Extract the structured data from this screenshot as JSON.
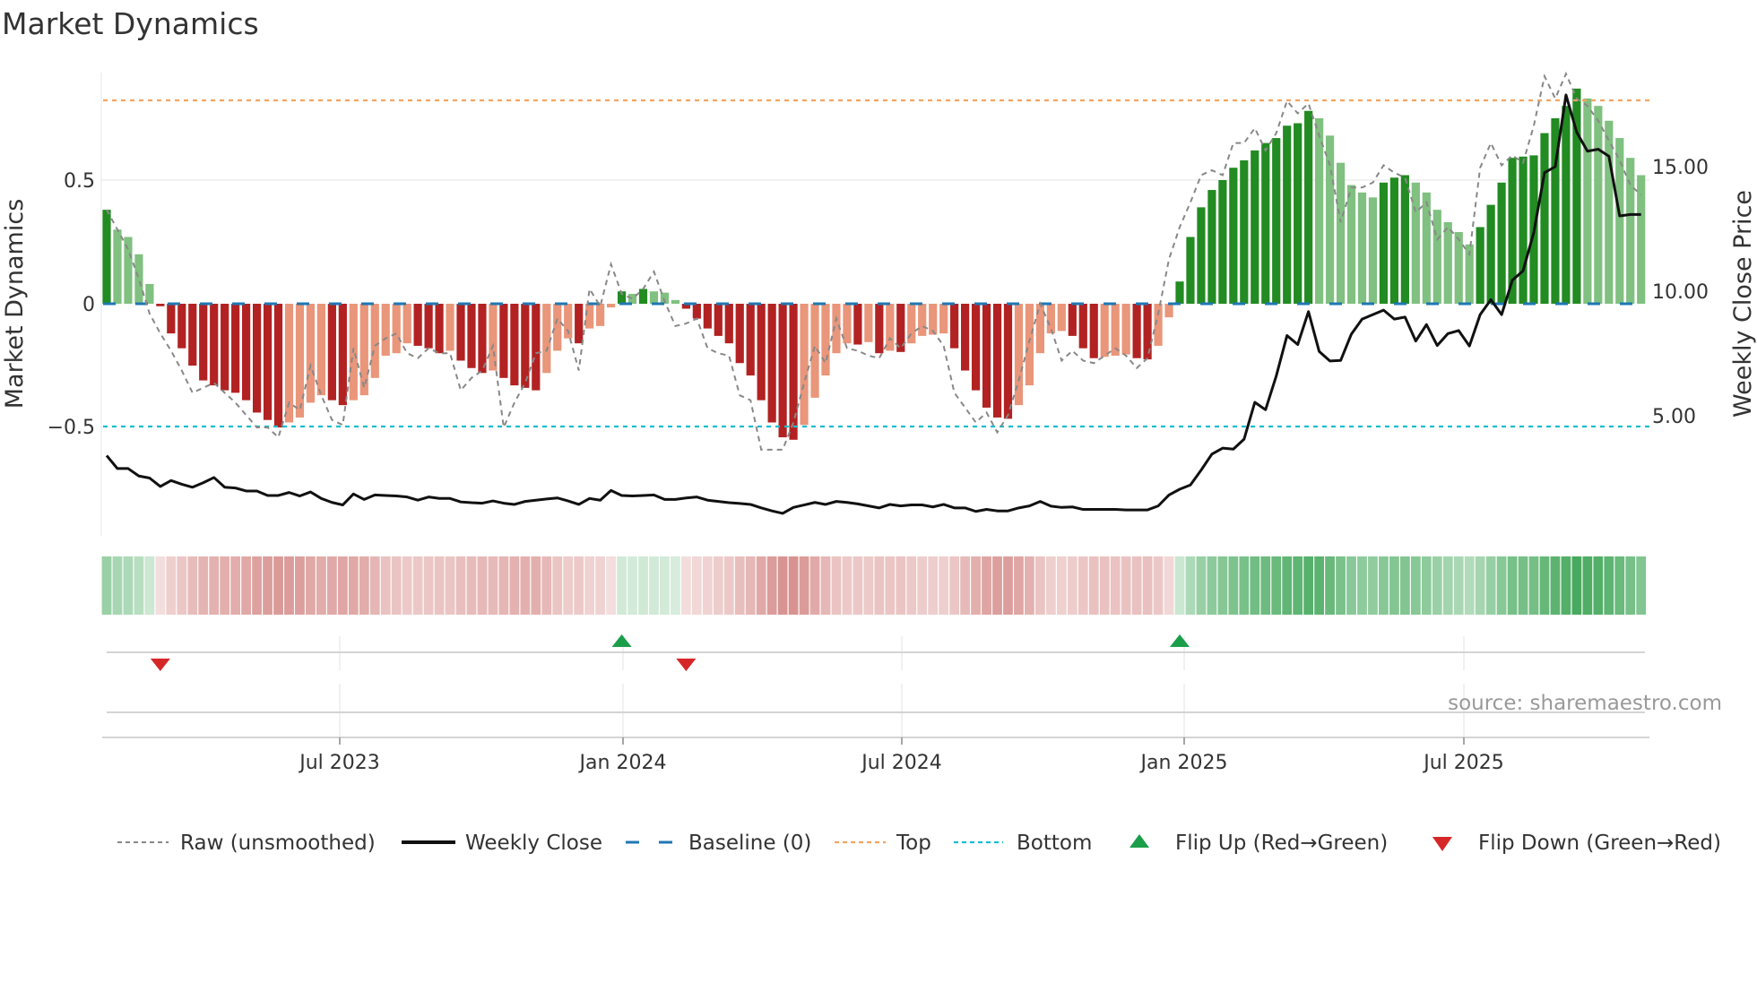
{
  "title": "Market Dynamics",
  "source": "source: sharemaestro.com",
  "colors": {
    "up_strong": "#228b22",
    "up_weak": "#80c080",
    "down_strong": "#b22222",
    "down_weak": "#e9967a",
    "raw": "#888888",
    "close": "#111111",
    "baseline": "#1f77b4",
    "top": "#f4a460",
    "bottom": "#17becf",
    "flip_up": "#1a9e4a",
    "flip_down": "#d62728",
    "strip_green": "#2e9e48",
    "strip_red": "#c0504d"
  },
  "legend": [
    {
      "label": "Raw (unsmoothed)",
      "icon": "dotted-gray-line"
    },
    {
      "label": "Weekly Close",
      "icon": "solid-black-line"
    },
    {
      "label": "Baseline (0)",
      "icon": "dashed-blue-line"
    },
    {
      "label": "Top",
      "icon": "dotted-orange-line"
    },
    {
      "label": "Bottom",
      "icon": "dotted-cyan-line"
    },
    {
      "label": "Flip Up (Red→Green)",
      "icon": "triangle-up-icon"
    },
    {
      "label": "Flip Down (Green→Red)",
      "icon": "triangle-down-icon"
    }
  ],
  "chart_data": {
    "type": "bar",
    "title": "Market Dynamics",
    "ylabel": "Market Dynamics",
    "y2label": "Weekly Close Price",
    "ylim": [
      -0.75,
      0.9
    ],
    "y_ticks": [
      "0.5",
      "0",
      "−0.5"
    ],
    "y2_ticks": [
      "15.00",
      "10.00",
      "5.00"
    ],
    "x_ticks": [
      "Jul 2023",
      "Jan 2024",
      "Jul 2024",
      "Jan 2025",
      "Jul 2025"
    ],
    "grid": true,
    "legend_position": "bottom",
    "top_level": 0.83,
    "bottom_level": -0.5,
    "baseline": 0,
    "frequency": "weekly",
    "momentum": [
      0.38,
      0.3,
      0.27,
      0.2,
      0.08,
      -0.01,
      -0.12,
      -0.18,
      -0.25,
      -0.31,
      -0.33,
      -0.35,
      -0.36,
      -0.39,
      -0.44,
      -0.47,
      -0.5,
      -0.48,
      -0.46,
      -0.4,
      -0.37,
      -0.39,
      -0.41,
      -0.39,
      -0.37,
      -0.3,
      -0.21,
      -0.2,
      -0.16,
      -0.17,
      -0.18,
      -0.2,
      -0.19,
      -0.23,
      -0.26,
      -0.28,
      -0.27,
      -0.3,
      -0.33,
      -0.34,
      -0.35,
      -0.28,
      -0.19,
      -0.14,
      -0.16,
      -0.1,
      -0.09,
      -0.015,
      0.05,
      0.04,
      0.06,
      0.05,
      0.045,
      0.015,
      -0.02,
      -0.06,
      -0.1,
      -0.13,
      -0.16,
      -0.24,
      -0.29,
      -0.39,
      -0.48,
      -0.54,
      -0.55,
      -0.49,
      -0.38,
      -0.29,
      -0.2,
      -0.16,
      -0.165,
      -0.155,
      -0.2,
      -0.19,
      -0.195,
      -0.16,
      -0.13,
      -0.125,
      -0.12,
      -0.18,
      -0.27,
      -0.35,
      -0.42,
      -0.46,
      -0.465,
      -0.41,
      -0.33,
      -0.2,
      -0.12,
      -0.11,
      -0.13,
      -0.18,
      -0.22,
      -0.215,
      -0.21,
      -0.205,
      -0.22,
      -0.225,
      -0.17,
      -0.055,
      0.09,
      0.27,
      0.39,
      0.46,
      0.5,
      0.55,
      0.58,
      0.62,
      0.65,
      0.67,
      0.72,
      0.73,
      0.78,
      0.75,
      0.68,
      0.57,
      0.48,
      0.45,
      0.43,
      0.49,
      0.51,
      0.52,
      0.49,
      0.45,
      0.38,
      0.33,
      0.29,
      0.24,
      0.31,
      0.4,
      0.49,
      0.59,
      0.595,
      0.6,
      0.69,
      0.75,
      0.8,
      0.87,
      0.83,
      0.8,
      0.74,
      0.67,
      0.59,
      0.52
    ],
    "raw": [
      0.38,
      0.3,
      0.22,
      0.1,
      -0.04,
      -0.12,
      -0.19,
      -0.27,
      -0.36,
      -0.34,
      -0.32,
      -0.36,
      -0.4,
      -0.45,
      -0.5,
      -0.5,
      -0.54,
      -0.4,
      -0.43,
      -0.25,
      -0.37,
      -0.47,
      -0.49,
      -0.18,
      -0.34,
      -0.17,
      -0.14,
      -0.12,
      -0.2,
      -0.22,
      -0.18,
      -0.2,
      -0.2,
      -0.35,
      -0.3,
      -0.27,
      -0.17,
      -0.5,
      -0.4,
      -0.32,
      -0.2,
      -0.19,
      -0.06,
      -0.11,
      -0.27,
      0.06,
      -0.01,
      0.16,
      0.04,
      0.02,
      0.06,
      0.13,
      0.01,
      -0.09,
      -0.08,
      -0.06,
      -0.18,
      -0.2,
      -0.21,
      -0.37,
      -0.39,
      -0.59,
      -0.59,
      -0.59,
      -0.48,
      -0.32,
      -0.17,
      -0.24,
      -0.06,
      -0.18,
      -0.19,
      -0.21,
      -0.22,
      -0.14,
      -0.18,
      -0.12,
      -0.09,
      -0.11,
      -0.17,
      -0.36,
      -0.42,
      -0.48,
      -0.44,
      -0.52,
      -0.45,
      -0.31,
      -0.15,
      0.0,
      -0.1,
      -0.23,
      -0.19,
      -0.23,
      -0.24,
      -0.21,
      -0.18,
      -0.21,
      -0.26,
      -0.22,
      -0.04,
      0.18,
      0.31,
      0.41,
      0.52,
      0.54,
      0.52,
      0.65,
      0.65,
      0.71,
      0.62,
      0.69,
      0.82,
      0.77,
      0.81,
      0.68,
      0.56,
      0.33,
      0.47,
      0.47,
      0.49,
      0.56,
      0.53,
      0.51,
      0.37,
      0.41,
      0.26,
      0.31,
      0.26,
      0.2,
      0.55,
      0.65,
      0.56,
      0.6,
      0.57,
      0.72,
      0.92,
      0.83,
      0.93,
      0.83,
      0.8,
      0.74,
      0.66,
      0.58,
      0.48,
      0.44
    ],
    "weekly_close": [
      3.4,
      2.88,
      2.88,
      2.58,
      2.5,
      2.16,
      2.4,
      2.25,
      2.13,
      2.31,
      2.52,
      2.13,
      2.1,
      1.98,
      1.98,
      1.8,
      1.8,
      1.92,
      1.78,
      1.94,
      1.68,
      1.52,
      1.42,
      1.86,
      1.64,
      1.82,
      1.8,
      1.78,
      1.74,
      1.61,
      1.74,
      1.68,
      1.68,
      1.54,
      1.51,
      1.49,
      1.58,
      1.49,
      1.44,
      1.56,
      1.61,
      1.66,
      1.7,
      1.58,
      1.44,
      1.68,
      1.61,
      2.0,
      1.8,
      1.78,
      1.8,
      1.82,
      1.64,
      1.64,
      1.7,
      1.74,
      1.61,
      1.56,
      1.51,
      1.48,
      1.44,
      1.3,
      1.18,
      1.08,
      1.32,
      1.42,
      1.52,
      1.44,
      1.56,
      1.52,
      1.46,
      1.38,
      1.3,
      1.44,
      1.38,
      1.42,
      1.42,
      1.34,
      1.44,
      1.3,
      1.3,
      1.16,
      1.24,
      1.18,
      1.18,
      1.3,
      1.38,
      1.56,
      1.37,
      1.32,
      1.34,
      1.24,
      1.24,
      1.24,
      1.24,
      1.22,
      1.22,
      1.22,
      1.38,
      1.82,
      2.05,
      2.22,
      2.82,
      3.46,
      3.7,
      3.66,
      4.06,
      5.54,
      5.24,
      6.6,
      8.22,
      7.86,
      9.18,
      7.58,
      7.2,
      7.22,
      8.28,
      8.88,
      9.06,
      9.24,
      8.88,
      8.96,
      8.0,
      8.66,
      7.82,
      8.3,
      8.42,
      7.8,
      9.06,
      9.66,
      9.06,
      10.44,
      10.82,
      12.36,
      14.76,
      15.0,
      17.88,
      16.38,
      15.62,
      15.7,
      15.42,
      13.02,
      13.08,
      13.08
    ],
    "flips": [
      {
        "type": "down",
        "week": 6
      },
      {
        "type": "up",
        "week": 49
      },
      {
        "type": "down",
        "week": 55
      },
      {
        "type": "up",
        "week": 101
      }
    ]
  }
}
